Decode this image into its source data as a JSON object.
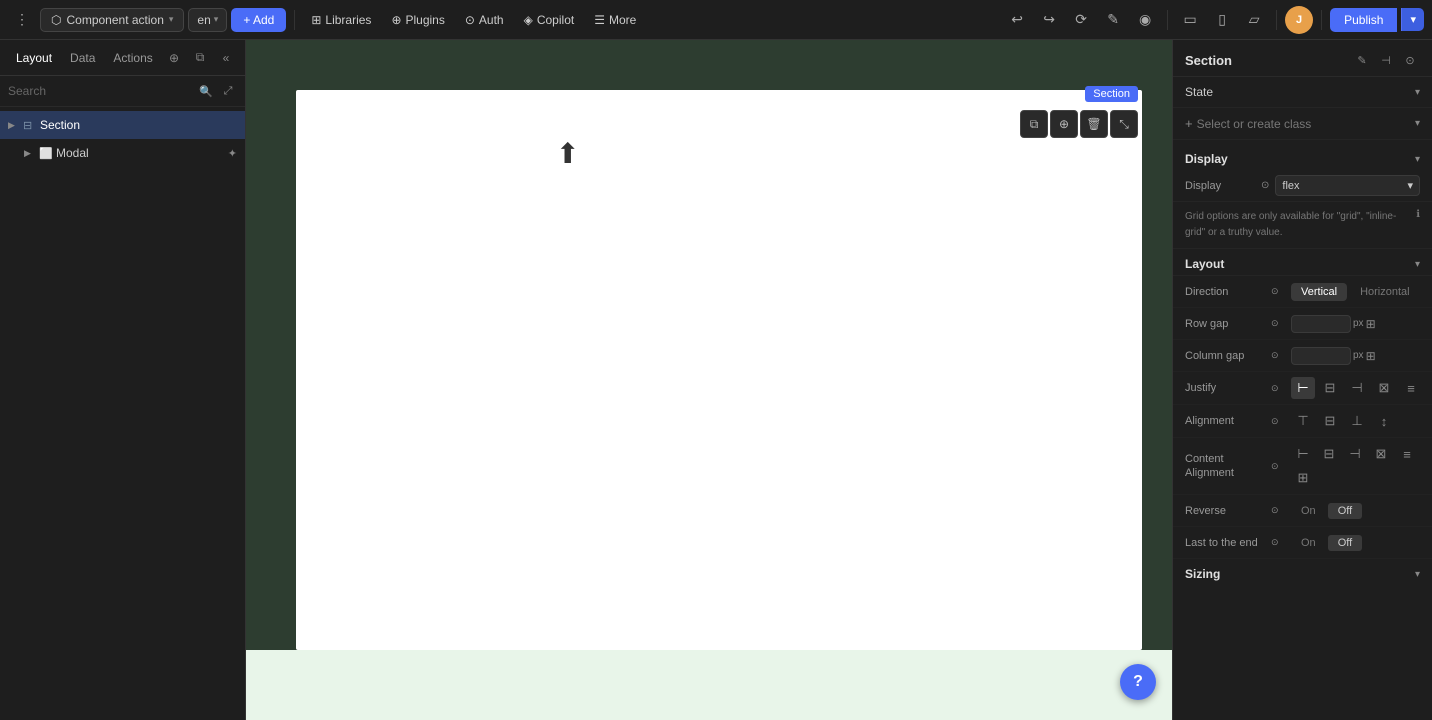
{
  "topbar": {
    "component_action": "Component action",
    "lang": "en",
    "add_label": "+ Add",
    "libraries_label": "Libraries",
    "plugins_label": "Plugins",
    "auth_label": "Auth",
    "copilot_label": "Copilot",
    "more_label": "More",
    "publish_label": "Publish",
    "avatar_initials": "J"
  },
  "left_panel": {
    "tabs": [
      "Layout",
      "Data",
      "Actions"
    ],
    "active_tab": "Layout",
    "search_placeholder": "Search",
    "tree_items": [
      {
        "label": "Section",
        "type": "section",
        "indent": 0,
        "selected": true
      },
      {
        "label": "Modal",
        "type": "modal",
        "indent": 1,
        "selected": false
      }
    ]
  },
  "canvas": {
    "section_label": "Section",
    "tools": [
      "copy",
      "duplicate",
      "delete",
      "expand"
    ]
  },
  "right_panel": {
    "title": "Section",
    "state_label": "State",
    "class_placeholder": "Select or create class",
    "display_section": "Display",
    "display_label": "Display",
    "display_value": "flex",
    "grid_info": "Grid options are only available for \"grid\", \"inline-grid\" or a truthy value.",
    "layout_section": "Layout",
    "direction_label": "Direction",
    "direction_options": [
      "Vertical",
      "Horizontal"
    ],
    "direction_active": "Vertical",
    "row_gap_label": "Row gap",
    "row_gap_value": "",
    "row_gap_unit": "px",
    "col_gap_label": "Column gap",
    "col_gap_value": "",
    "col_gap_unit": "px",
    "justify_label": "Justify",
    "alignment_label": "Alignment",
    "content_align_label": "Content Alignment",
    "reverse_label": "Reverse",
    "last_to_end_label": "Last to the end",
    "on_label": "On",
    "off_label": "Off",
    "sizing_section": "Sizing"
  }
}
